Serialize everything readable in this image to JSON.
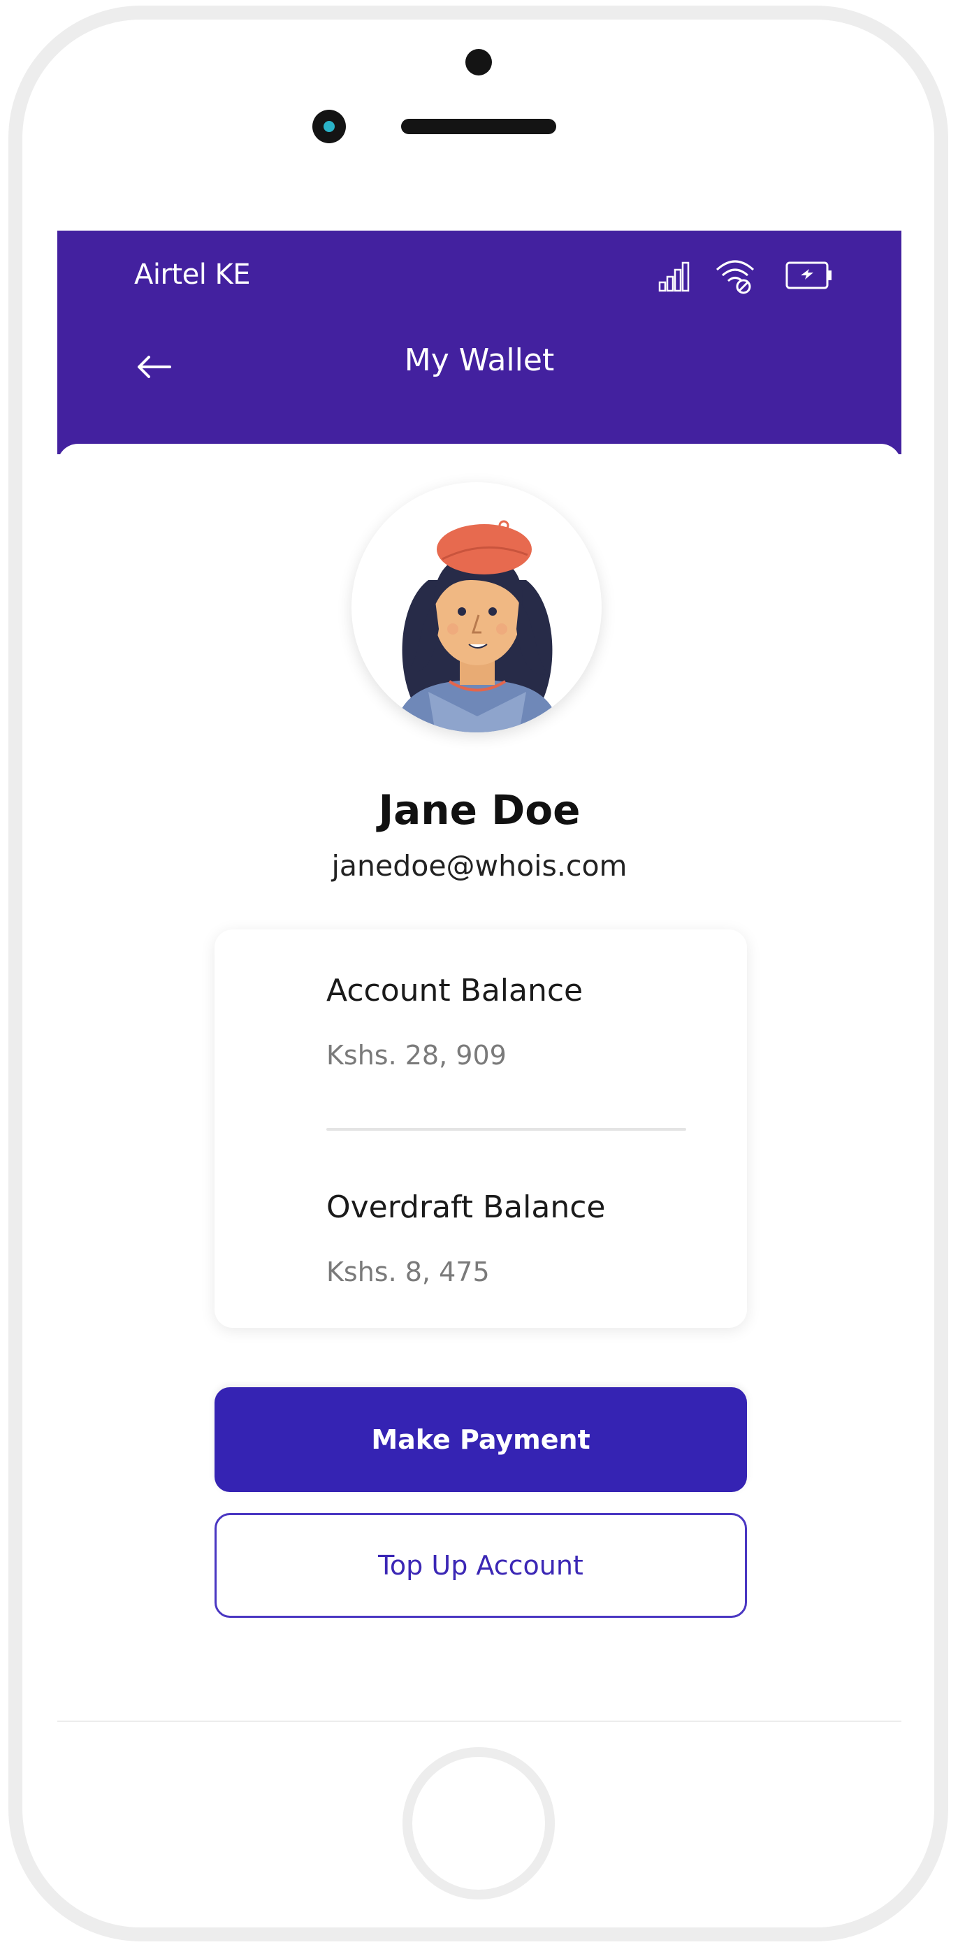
{
  "status_bar": {
    "carrier": "Airtel KE",
    "icons": [
      "signal-icon",
      "wifi-icon",
      "battery-icon"
    ]
  },
  "header": {
    "title": "My Wallet",
    "back_icon": "arrow-left-icon"
  },
  "profile": {
    "name": "Jane Doe",
    "email": "janedoe@whois.com",
    "avatar_icon": "woman-avatar-illustration"
  },
  "balances": [
    {
      "label": "Account Balance",
      "value": "Kshs. 28, 909"
    },
    {
      "label": "Overdraft Balance",
      "value": "Kshs. 8, 475"
    }
  ],
  "actions": {
    "primary_label": "Make Payment",
    "secondary_label": "Top Up Account"
  },
  "colors": {
    "header": "#43219f",
    "primary_button": "#3523b3",
    "secondary_border": "#4a37c2",
    "secondary_text": "#3b27b5"
  }
}
